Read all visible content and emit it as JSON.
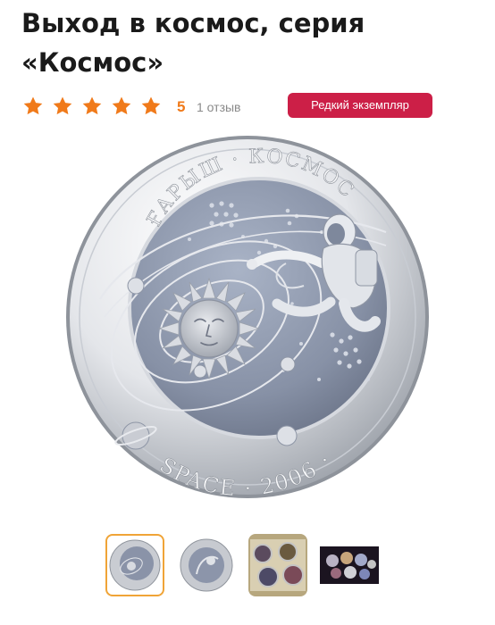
{
  "product": {
    "title": "Выход в космос, серия «Космос»",
    "rating_value": "5",
    "review_count_text": "1 отзыв",
    "star_count": 5,
    "star_color": "#F07A1A",
    "badge_label": "Редкий экземпляр",
    "badge_color": "#CC1F47"
  },
  "coin": {
    "top_inscription": "ҒАРЫШ · КОСМОС",
    "bottom_inscription": "SPACE · 2006 ·"
  },
  "gallery": {
    "selected_index": 0,
    "thumbnails": [
      "coin-reverse",
      "coin-obverse",
      "coin-set-photo",
      "coin-collection-display"
    ],
    "selected_border_color": "#F0A437"
  }
}
